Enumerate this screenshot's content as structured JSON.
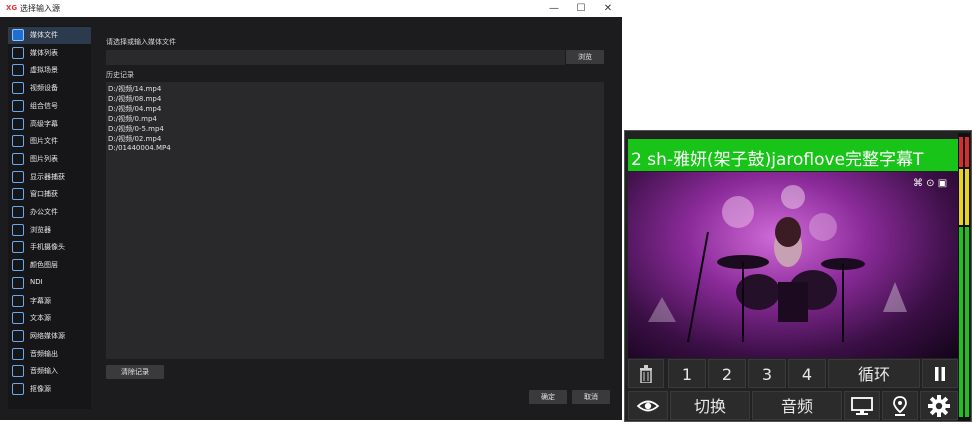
{
  "window": {
    "logo": "XG",
    "title": "选择输入源",
    "controls": {
      "minimize": "—",
      "maximize": "☐",
      "close": "✕"
    }
  },
  "sidebar": {
    "items": [
      {
        "label": "媒体文件",
        "icon": "media-file-icon",
        "active": true
      },
      {
        "label": "媒体列表",
        "icon": "media-list-icon"
      },
      {
        "label": "虚拟场景",
        "icon": "virtual-scene-icon"
      },
      {
        "label": "视频设备",
        "icon": "video-device-icon"
      },
      {
        "label": "组合信号",
        "icon": "combined-signal-icon"
      },
      {
        "label": "高级字幕",
        "icon": "advanced-caption-icon"
      },
      {
        "label": "图片文件",
        "icon": "image-file-icon"
      },
      {
        "label": "图片列表",
        "icon": "image-list-icon"
      },
      {
        "label": "显示器捕获",
        "icon": "monitor-capture-icon"
      },
      {
        "label": "窗口捕获",
        "icon": "window-capture-icon"
      },
      {
        "label": "办公文件",
        "icon": "office-file-icon"
      },
      {
        "label": "浏览器",
        "icon": "browser-icon"
      },
      {
        "label": "手机摄像头",
        "icon": "phone-camera-icon"
      },
      {
        "label": "颜色图层",
        "icon": "color-layer-icon"
      },
      {
        "label": "NDI",
        "icon": "ndi-icon"
      },
      {
        "label": "字幕源",
        "icon": "caption-source-icon"
      },
      {
        "label": "文本源",
        "icon": "text-source-icon"
      },
      {
        "label": "网络媒体源",
        "icon": "network-media-icon"
      },
      {
        "label": "音频输出",
        "icon": "audio-output-icon"
      },
      {
        "label": "音频输入",
        "icon": "audio-input-icon"
      },
      {
        "label": "抠像源",
        "icon": "keying-source-icon"
      }
    ]
  },
  "main": {
    "prompt": "请选择或输入媒体文件",
    "path_value": "",
    "browse_label": "浏览",
    "history_label": "历史记录",
    "history": [
      "D:/视频/14.mp4",
      "D:/视频/08.mp4",
      "D:/视频/04.mp4",
      "D:/视频/0.mp4",
      "D:/视频/0-5.mp4",
      "D:/视频/02.mp4",
      "D:/01440004.MP4"
    ],
    "clear_label": "清除记录",
    "ok_label": "确定",
    "cancel_label": "取消"
  },
  "preview": {
    "title": "2 sh-雅妍(架子鼓)jaroflove完整字幕T",
    "title_bg": "#18c418",
    "row1": {
      "delete_icon": "trash-icon",
      "b1": "1",
      "b2": "2",
      "b3": "3",
      "b4": "4",
      "loop": "循环",
      "pause_icon": "pause-icon"
    },
    "row2": {
      "eye_icon": "eye-icon",
      "switch": "切换",
      "audio": "音频",
      "monitor_icon": "monitor-icon",
      "pin_icon": "location-pin-icon",
      "gear_icon": "gear-icon"
    }
  }
}
